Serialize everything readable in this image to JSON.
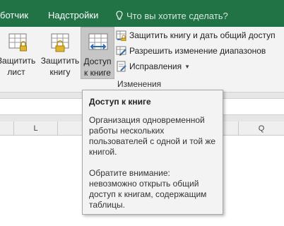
{
  "tabs": {
    "developer": "ботчик",
    "addins": "Надстройки"
  },
  "tell_me": {
    "icon": "lightbulb-icon",
    "placeholder": "Что вы хотите сделать?"
  },
  "ribbon": {
    "buttons": [
      {
        "icon": "protect-sheet-icon",
        "label": "Защитить\nлист"
      },
      {
        "icon": "protect-workbook-icon",
        "label": "Защитить\nкнигу"
      },
      {
        "icon": "share-workbook-icon",
        "label": "Доступ\nк книге",
        "highlighted": true
      }
    ],
    "small_buttons": [
      {
        "icon": "protect-share-icon",
        "label": "Защитить книгу и дать общий доступ"
      },
      {
        "icon": "allow-edit-ranges-icon",
        "label": "Разрешить изменение диапазонов"
      },
      {
        "icon": "track-changes-icon",
        "label": "Исправления",
        "has_dropdown": true
      }
    ],
    "group_label": "Изменения"
  },
  "columns": [
    "L",
    "Q"
  ],
  "tooltip": {
    "title": "Доступ к книге",
    "body": "Организация одновременной работы нескольких пользователей с одной и той же книгой.",
    "note": "Обратите внимание: невозможно открыть общий доступ к книгам, содержащим таблицы."
  },
  "colors": {
    "tab_bar": "#217346",
    "ribbon_bg": "#f3f3f3",
    "highlight": "#c6c6c6"
  }
}
